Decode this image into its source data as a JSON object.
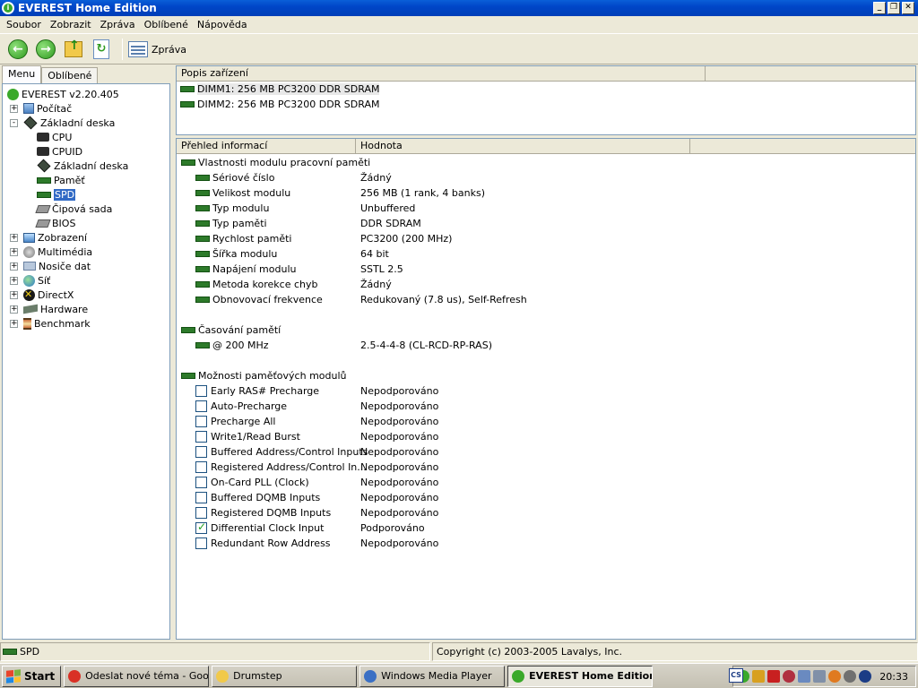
{
  "window": {
    "title": "EVEREST Home Edition"
  },
  "menu": [
    "Soubor",
    "Zobrazit",
    "Zpráva",
    "Oblíbené",
    "Nápověda"
  ],
  "toolbar": {
    "report_label": "Zpráva"
  },
  "left": {
    "tabs": [
      "Menu",
      "Oblíbené"
    ],
    "tree": [
      {
        "label": "EVEREST v2.20.405",
        "icon": "everest-icon",
        "level": 0,
        "exp": ""
      },
      {
        "label": "Počítač",
        "icon": "computer-icon",
        "level": 0,
        "exp": "+"
      },
      {
        "label": "Základní deska",
        "icon": "motherboard-icon",
        "level": 0,
        "exp": "-"
      },
      {
        "label": "CPU",
        "icon": "cpu-icon",
        "level": 1,
        "exp": ""
      },
      {
        "label": "CPUID",
        "icon": "cpu-icon",
        "level": 1,
        "exp": ""
      },
      {
        "label": "Základní deska",
        "icon": "motherboard-icon",
        "level": 1,
        "exp": ""
      },
      {
        "label": "Paměť",
        "icon": "memory-icon",
        "level": 1,
        "exp": ""
      },
      {
        "label": "SPD",
        "icon": "memory-icon",
        "level": 1,
        "exp": "",
        "selected": true
      },
      {
        "label": "Čipová sada",
        "icon": "chipset-icon",
        "level": 1,
        "exp": ""
      },
      {
        "label": "BIOS",
        "icon": "chipset-icon",
        "level": 1,
        "exp": ""
      },
      {
        "label": "Zobrazení",
        "icon": "monitor-icon",
        "level": 0,
        "exp": "+"
      },
      {
        "label": "Multimédia",
        "icon": "speaker-icon",
        "level": 0,
        "exp": "+"
      },
      {
        "label": "Nosiče dat",
        "icon": "storage-icon",
        "level": 0,
        "exp": "+"
      },
      {
        "label": "Síť",
        "icon": "network-icon",
        "level": 0,
        "exp": "+"
      },
      {
        "label": "DirectX",
        "icon": "directx-icon",
        "level": 0,
        "exp": "+"
      },
      {
        "label": "Hardware",
        "icon": "hardware-icon",
        "level": 0,
        "exp": "+"
      },
      {
        "label": "Benchmark",
        "icon": "hourglass-icon",
        "level": 0,
        "exp": "+"
      }
    ]
  },
  "devices": {
    "header": "Popis zařízení",
    "items": [
      "DIMM1: 256 MB PC3200 DDR SDRAM",
      "DIMM2: 256 MB PC3200 DDR SDRAM"
    ]
  },
  "info": {
    "col_field": "Přehled informací",
    "col_value": "Hodnota",
    "sections": [
      {
        "title": "Vlastnosti modulu pracovní paměti",
        "rows": [
          {
            "field": "Sériové číslo",
            "value": "Žádný"
          },
          {
            "field": "Velikost modulu",
            "value": "256 MB (1 rank, 4 banks)"
          },
          {
            "field": "Typ modulu",
            "value": "Unbuffered"
          },
          {
            "field": "Typ paměti",
            "value": "DDR SDRAM"
          },
          {
            "field": "Rychlost paměti",
            "value": "PC3200 (200 MHz)"
          },
          {
            "field": "Šířka modulu",
            "value": "64 bit"
          },
          {
            "field": "Napájení modulu",
            "value": "SSTL 2.5"
          },
          {
            "field": "Metoda korekce chyb",
            "value": "Žádný"
          },
          {
            "field": "Obnovovací frekvence",
            "value": "Redukovaný (7.8 us), Self-Refresh"
          }
        ]
      },
      {
        "title": "Časování pamětí",
        "rows": [
          {
            "field": "@ 200 MHz",
            "value": "2.5-4-4-8  (CL-RCD-RP-RAS)"
          }
        ]
      },
      {
        "title": "Možnosti paměťových modulů",
        "checkbox": true,
        "rows": [
          {
            "field": "Early RAS# Precharge",
            "value": "Nepodporováno",
            "checked": false
          },
          {
            "field": "Auto-Precharge",
            "value": "Nepodporováno",
            "checked": false
          },
          {
            "field": "Precharge All",
            "value": "Nepodporováno",
            "checked": false
          },
          {
            "field": "Write1/Read Burst",
            "value": "Nepodporováno",
            "checked": false
          },
          {
            "field": "Buffered Address/Control Inputs",
            "value": "Nepodporováno",
            "checked": false
          },
          {
            "field": "Registered Address/Control In...",
            "value": "Nepodporováno",
            "checked": false
          },
          {
            "field": "On-Card PLL (Clock)",
            "value": "Nepodporováno",
            "checked": false
          },
          {
            "field": "Buffered DQMB Inputs",
            "value": "Nepodporováno",
            "checked": false
          },
          {
            "field": "Registered DQMB Inputs",
            "value": "Nepodporováno",
            "checked": false
          },
          {
            "field": "Differential Clock Input",
            "value": "Podporováno",
            "checked": true
          },
          {
            "field": "Redundant Row Address",
            "value": "Nepodporováno",
            "checked": false
          }
        ]
      }
    ]
  },
  "status": {
    "left": "SPD",
    "right": "Copyright (c) 2003-2005 Lavalys, Inc."
  },
  "taskbar": {
    "start": "Start",
    "tasks": [
      {
        "label": "Odeslat nové téma - Goo...",
        "icon": "chrome-icon",
        "color": "#d93025"
      },
      {
        "label": "Drumstep",
        "icon": "folder-icon",
        "color": "#f1c94a"
      },
      {
        "label": "Windows Media Player",
        "icon": "media-player-icon",
        "color": "#3a6fc4"
      },
      {
        "label": "EVEREST Home Edition",
        "icon": "everest-icon",
        "color": "#3aa92a",
        "active": true
      }
    ],
    "clock": "20:33"
  }
}
